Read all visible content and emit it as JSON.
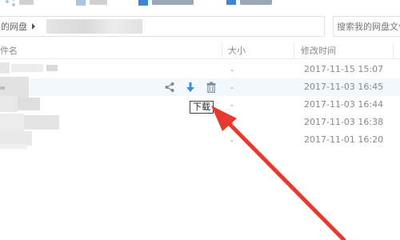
{
  "toolbar": {
    "items": [
      {
        "icon": "share-icon"
      },
      {
        "icon": "upload-icon"
      },
      {
        "icon": "new-folder-icon"
      },
      {
        "icon": "remote-download-icon"
      }
    ]
  },
  "address": {
    "root_label": "的网盘",
    "search_placeholder": "搜索我的网盘文件"
  },
  "table": {
    "headers": {
      "name": "件名",
      "size": "大小",
      "modified": "修改时间"
    },
    "rows": [
      {
        "size": "-",
        "modified": "2017-11-15 15:07"
      },
      {
        "size": "-",
        "modified": "2017-11-03 16:45"
      },
      {
        "size": "-",
        "modified": "2017-11-03 16:44"
      },
      {
        "size": "-",
        "modified": "2017-11-03 16:38"
      },
      {
        "size": "-",
        "modified": "2017-11-01 16:20"
      }
    ],
    "row_actions": {
      "share_icon": "share-icon",
      "download_icon": "download-icon",
      "delete_icon": "trash-icon"
    }
  },
  "tooltip": {
    "text": "下载"
  },
  "colors": {
    "accent": "#2f8fe6",
    "annotation_arrow": "#e8392f",
    "hover_row": "#f3f8fd"
  }
}
